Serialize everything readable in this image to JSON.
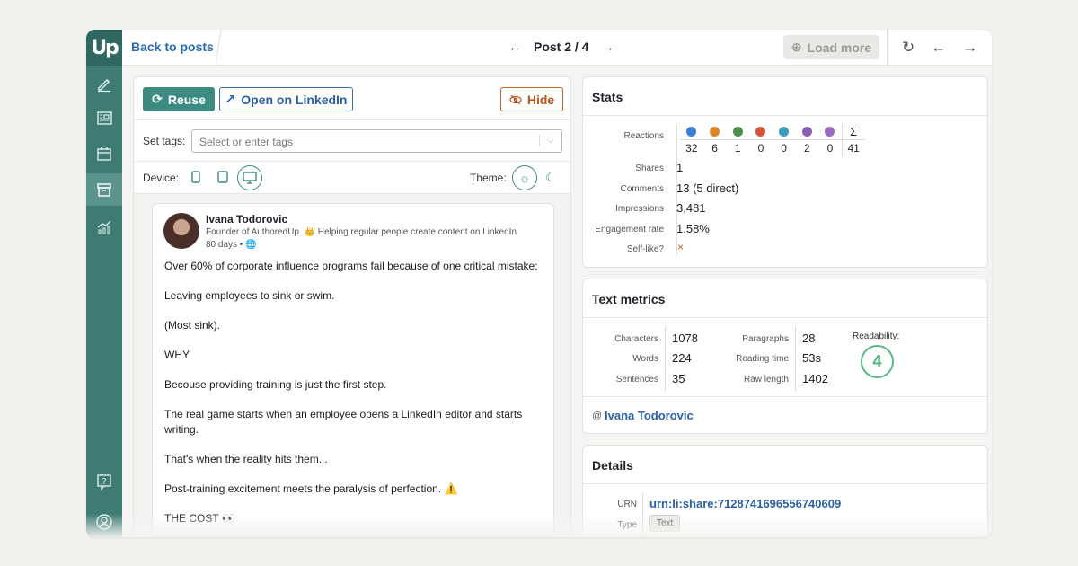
{
  "topbar": {
    "back_label": "Back to posts",
    "post_counter": "Post 2 / 4",
    "prev_arrow": "←",
    "next_arrow": "→",
    "load_more_label": "Load more",
    "refresh_glyph": "↻",
    "nav_back_glyph": "←",
    "nav_forward_glyph": "→"
  },
  "sidebar": {
    "logo_text": "Up",
    "items": [
      {
        "icon": "pencil-icon"
      },
      {
        "icon": "news-icon"
      },
      {
        "icon": "calendar-icon"
      },
      {
        "icon": "archive-icon",
        "active": true
      },
      {
        "icon": "analytics-icon"
      },
      {
        "icon": "help-icon"
      },
      {
        "icon": "user-icon"
      }
    ]
  },
  "actions": {
    "reuse_label": "Reuse",
    "open_linkedin_label": "Open on LinkedIn",
    "hide_label": "Hide"
  },
  "tags": {
    "label": "Set tags:",
    "placeholder": "Select or enter tags"
  },
  "device": {
    "label": "Device:",
    "selected": "desktop"
  },
  "theme": {
    "label": "Theme:",
    "selected": "light"
  },
  "post": {
    "author_name": "Ivana Todorovic",
    "author_headline": "Founder of AuthoredUp. 👑 Helping regular people create content on LinkedIn",
    "age": "80 days •",
    "paragraphs": [
      "Over 60% of corporate influence programs fail because of one critical mistake:",
      "Leaving employees to sink or swim.",
      "(Most sink).",
      "WHY",
      "Becouse providing training is just the first step.",
      "The real game starts when an employee opens a LinkedIn editor and starts writing.",
      "That's when the reality hits them...",
      "Post-training excitement meets the paralysis of perfection. ⚠️",
      "THE COST 👀"
    ]
  },
  "stats": {
    "title": "Stats",
    "reactions_label": "Reactions",
    "reactions": [
      {
        "icon": "like-icon",
        "color": "#3d7fd6",
        "value": "32"
      },
      {
        "icon": "celebrate-icon",
        "color": "#d9862b",
        "value": "6"
      },
      {
        "icon": "support-icon",
        "color": "#4e8d4a",
        "value": "1"
      },
      {
        "icon": "love-icon",
        "color": "#d4553a",
        "value": "0"
      },
      {
        "icon": "insightful-icon",
        "color": "#3b9bb8",
        "value": "0"
      },
      {
        "icon": "funny-icon",
        "color": "#8a5fb0",
        "value": "2"
      },
      {
        "icon": "curious-icon",
        "color": "#9b6ab8",
        "value": "0"
      }
    ],
    "sum_glyph": "Σ",
    "sum_value": "41",
    "rows": [
      {
        "label": "Shares",
        "value": "1"
      },
      {
        "label": "Comments",
        "value": "13 (5 direct)"
      },
      {
        "label": "Impressions",
        "value": "3,481"
      },
      {
        "label": "Engagement rate",
        "value": "1.58%"
      },
      {
        "label": "Self-like?",
        "value": "×"
      }
    ]
  },
  "text_metrics": {
    "title": "Text metrics",
    "col1": [
      {
        "label": "Characters",
        "value": "1078"
      },
      {
        "label": "Words",
        "value": "224"
      },
      {
        "label": "Sentences",
        "value": "35"
      }
    ],
    "col2": [
      {
        "label": "Paragraphs",
        "value": "28"
      },
      {
        "label": "Reading time",
        "value": "53s"
      },
      {
        "label": "Raw length",
        "value": "1402"
      }
    ],
    "readability_label": "Readability:",
    "readability_value": "4",
    "mention_at": "@",
    "mention_name": "Ivana Todorovic"
  },
  "details": {
    "title": "Details",
    "urn_label": "URN",
    "urn_value": "urn:li:share:7128741696556740609",
    "type_label": "Type",
    "type_value": "Text"
  },
  "colors": {
    "sidebar": "#3d7b73",
    "accent": "#3d8b80",
    "link": "#2b5fa4",
    "hide": "#b8521c",
    "readability": "#59b987"
  }
}
